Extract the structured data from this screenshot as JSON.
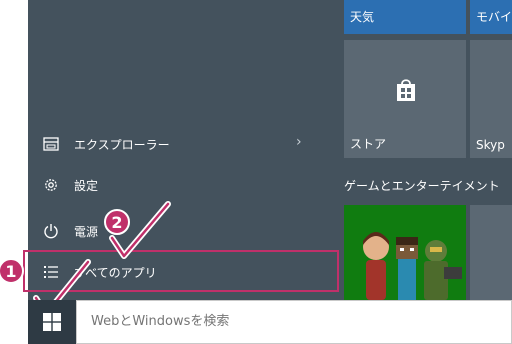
{
  "tiles": {
    "weather": "天気",
    "mobile": "モバイ",
    "store": "ストア",
    "skype": "Skyp"
  },
  "group_title": "ゲームとエンターテイメント",
  "menu": {
    "explorer": "エクスプローラー",
    "settings": "設定",
    "power": "電源",
    "all_apps": "すべてのアプリ"
  },
  "search": {
    "placeholder": "WebとWindowsを検索"
  },
  "badges": {
    "one": "1",
    "two": "2"
  },
  "colors": {
    "accent": "#c0306a",
    "menu_bg": "#44525d",
    "tile_blue": "#2c6fb2",
    "xbox_green": "#107c10"
  }
}
